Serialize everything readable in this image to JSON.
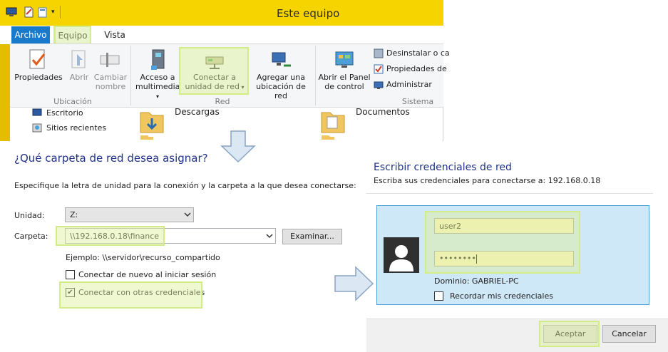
{
  "explorer": {
    "title": "Este equipo",
    "tabs": [
      "Archivo",
      "Equipo",
      "Vista"
    ],
    "ribbon": {
      "ubicacion": {
        "label": "Ubicación",
        "propiedades": "Propiedades",
        "abrir": "Abrir",
        "cambiar_line1": "Cambiar",
        "cambiar_line2": "nombre"
      },
      "red": {
        "label": "Red",
        "acceso_line1": "Acceso a",
        "acceso_line2": "multimedia",
        "conectar_line1": "Conectar a",
        "conectar_line2": "unidad de red",
        "agregar_line1": "Agregar una",
        "agregar_line2": "ubicación de red"
      },
      "sistema": {
        "label": "Sistema",
        "panel_line1": "Abrir el Panel",
        "panel_line2": "de control",
        "desinstalar": "Desinstalar o ca",
        "propiedades": "Propiedades de",
        "administrar": "Administrar"
      }
    },
    "nav": [
      "Escritorio",
      "Sitios recientes"
    ],
    "folders": [
      "Descargas",
      "Documentos"
    ]
  },
  "map_drive": {
    "heading": "¿Qué carpeta de red desea asignar?",
    "description": "Especifique la letra de unidad para la conexión y la carpeta a la que desea conectarse:",
    "drive_label": "Unidad:",
    "drive_value": "Z:",
    "folder_label": "Carpeta:",
    "folder_value": "\\\\192.168.0.18\\finance",
    "browse_label": "Examinar...",
    "example": "Ejemplo: \\\\servidor\\recurso_compartido",
    "reconnect_label": "Conectar de nuevo al iniciar sesión",
    "reconnect_checked": false,
    "other_creds_label": "Conectar con otras credenciales",
    "other_creds_checked": true
  },
  "credentials": {
    "heading": "Escribir credenciales de red",
    "subtitle": "Escriba sus credenciales para conectarse a: 192.168.0.18",
    "username": "user2",
    "password_mask": "••••••••",
    "domain": "Dominio: GABRIEL-PC",
    "remember_label": "Recordar mis credenciales",
    "remember_checked": false,
    "accept_label": "Aceptar",
    "cancel_label": "Cancelar"
  },
  "colors": {
    "titlebar": "#f5d400",
    "file_tab": "#1979ca",
    "highlight": "#d2ec8a",
    "heading_blue": "#1e3287",
    "cred_panel": "#cfe8f7"
  },
  "checkmark": "✔"
}
